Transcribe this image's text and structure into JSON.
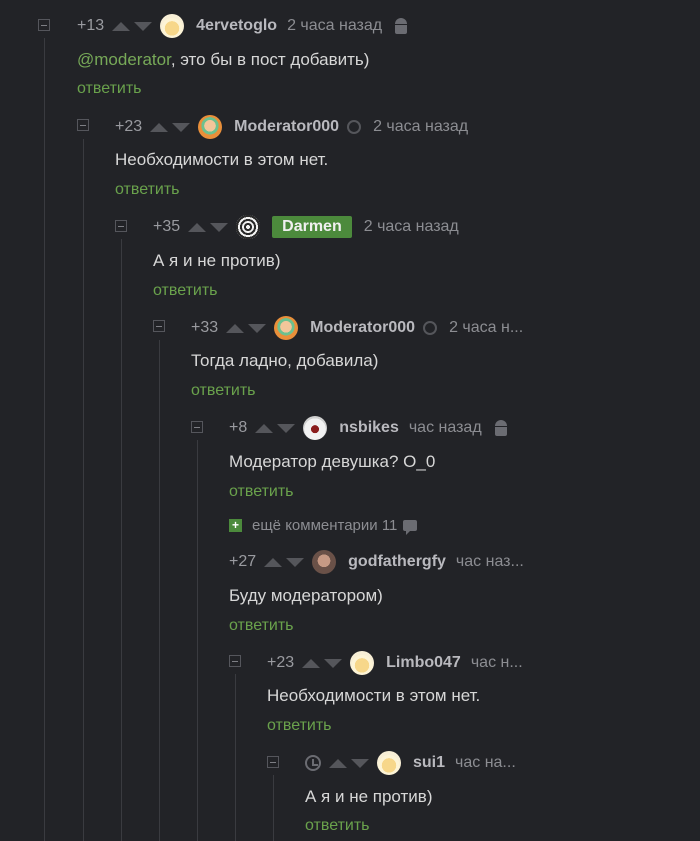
{
  "comments": [
    {
      "rating": "+13",
      "username": "4ervetoglo",
      "time": "2 часа назад",
      "text": "@moderator, это бы в пост добавить)",
      "mention": "@moderator",
      "reply": "ответить",
      "device": "android-icon"
    },
    {
      "rating": "+23",
      "username": "Moderator000",
      "time": "2 часа назад",
      "text": "Необходимости в этом нет.",
      "reply": "ответить",
      "device": "moderator-badge-icon"
    },
    {
      "rating": "+35",
      "username": "Darmen",
      "time": "2 часа назад",
      "text": "А я и не против)",
      "reply": "ответить"
    },
    {
      "rating": "+33",
      "username": "Moderator000",
      "time": "2 часа н...",
      "text": "Тогда ладно, добавила)",
      "reply": "ответить",
      "device": "moderator-badge-icon"
    },
    {
      "rating": "+8",
      "username": "nsbikes",
      "time": "час назад",
      "text": "Модератор девушка? О_0",
      "reply": "ответить",
      "device": "android-icon"
    },
    {
      "rating": "+27",
      "username": "godfathergfy",
      "time": "час наз...",
      "text": "Буду модератором)",
      "reply": "ответить"
    },
    {
      "rating": "+23",
      "username": "Limbo047",
      "time": "час н...",
      "text": "Необходимости в этом нет.",
      "reply": "ответить"
    },
    {
      "rating": "",
      "username": "sui1",
      "time": "час на...",
      "text": "А я и не против)",
      "reply": "ответить"
    }
  ],
  "more_comments": {
    "label": "ещё комментарии 11",
    "plus": "+"
  },
  "colors": {
    "background": "#222327",
    "accent": "#6aa24c",
    "badge": "#4c8a3c"
  }
}
